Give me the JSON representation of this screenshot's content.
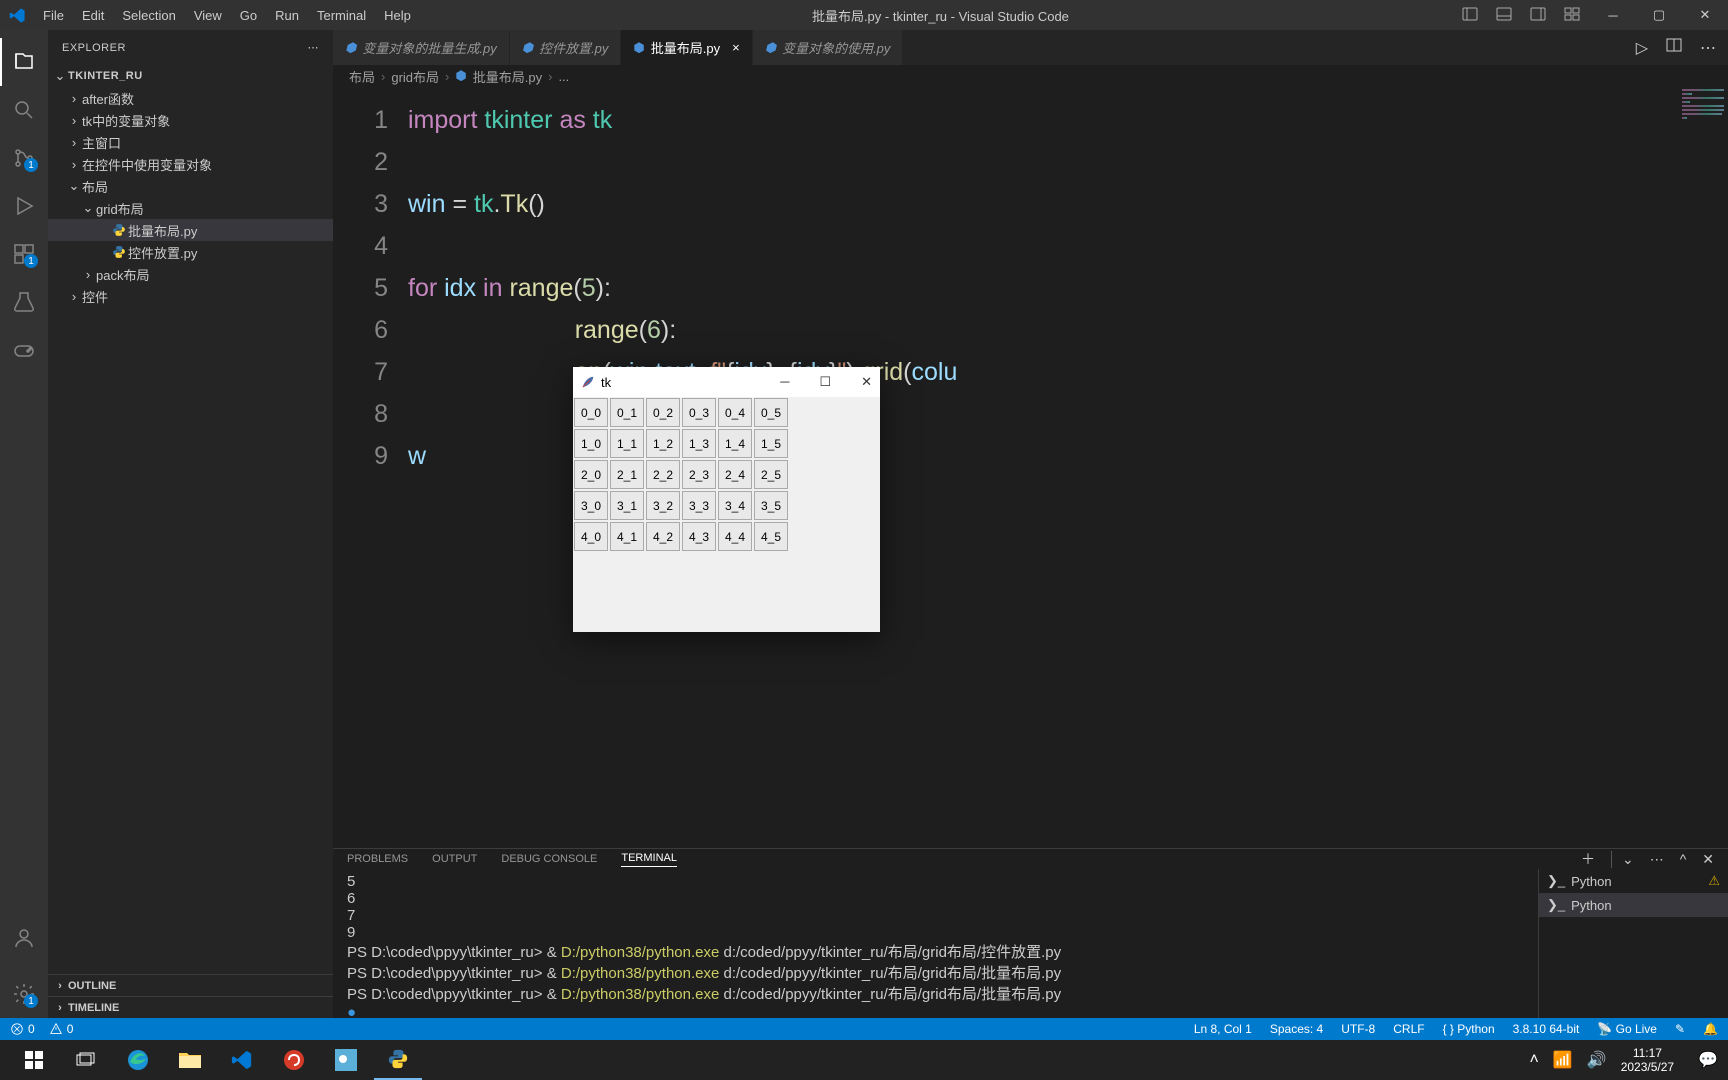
{
  "titlebar": {
    "menu": [
      "File",
      "Edit",
      "Selection",
      "View",
      "Go",
      "Run",
      "Terminal",
      "Help"
    ],
    "title": "批量布局.py - tkinter_ru - Visual Studio Code"
  },
  "activity": {
    "badge_scm": "1",
    "badge_ext": "1",
    "badge_settings": "1"
  },
  "sidebar": {
    "header": "EXPLORER",
    "root": "TKINTER_RU",
    "items": [
      {
        "label": "after函数",
        "indent": 1,
        "chev": ">"
      },
      {
        "label": "tk中的变量对象",
        "indent": 1,
        "chev": ">"
      },
      {
        "label": "主窗口",
        "indent": 1,
        "chev": ">"
      },
      {
        "label": "在控件中使用变量对象",
        "indent": 1,
        "chev": ">"
      },
      {
        "label": "布局",
        "indent": 1,
        "chev": "v"
      },
      {
        "label": "grid布局",
        "indent": 2,
        "chev": "v"
      },
      {
        "label": "批量布局.py",
        "indent": 3,
        "icon": "py",
        "selected": true
      },
      {
        "label": "控件放置.py",
        "indent": 3,
        "icon": "py"
      },
      {
        "label": "pack布局",
        "indent": 2,
        "chev": ">"
      },
      {
        "label": "控件",
        "indent": 1,
        "chev": ">"
      }
    ],
    "outline": "OUTLINE",
    "timeline": "TIMELINE"
  },
  "tabs": [
    {
      "label": "变量对象的批量生成.py",
      "icon": "py",
      "italic": true
    },
    {
      "label": "控件放置.py",
      "icon": "py",
      "italic": true
    },
    {
      "label": "批量布局.py",
      "icon": "py",
      "active": true,
      "close": "×"
    },
    {
      "label": "变量对象的使用.py",
      "icon": "py",
      "italic": true
    }
  ],
  "breadcrumb": [
    "布局",
    "grid布局",
    "批量布局.py",
    "..."
  ],
  "code": {
    "lines": [
      {
        "num": "1",
        "segments": [
          [
            "import ",
            "kw"
          ],
          [
            "tkinter ",
            "mod"
          ],
          [
            "as ",
            "kw"
          ],
          [
            "tk",
            "mod"
          ]
        ]
      },
      {
        "num": "2",
        "segments": []
      },
      {
        "num": "3",
        "segments": [
          [
            "win ",
            "var"
          ],
          [
            "= ",
            "punct"
          ],
          [
            "tk",
            "mod"
          ],
          [
            ".",
            "punct"
          ],
          [
            "Tk",
            "func"
          ],
          [
            "()",
            "punct"
          ]
        ]
      },
      {
        "num": "4",
        "segments": []
      },
      {
        "num": "5",
        "segments": [
          [
            "for ",
            "kw"
          ],
          [
            "idx ",
            "var"
          ],
          [
            "in ",
            "kw"
          ],
          [
            "range",
            "func"
          ],
          [
            "(",
            "punct"
          ],
          [
            "5",
            "num"
          ],
          [
            "):",
            "punct"
          ]
        ]
      },
      {
        "num": "6",
        "segments": [
          [
            "                        range",
            "func"
          ],
          [
            "(",
            "punct"
          ],
          [
            "6",
            "num"
          ],
          [
            "):",
            "punct"
          ]
        ]
      },
      {
        "num": "7",
        "segments": [
          [
            "                        on",
            "func"
          ],
          [
            "(",
            "punct"
          ],
          [
            "win",
            "var"
          ],
          [
            ",",
            "punct"
          ],
          [
            "text",
            "var"
          ],
          [
            "=",
            "punct"
          ],
          [
            "f\"",
            "str"
          ],
          [
            "{",
            "punct"
          ],
          [
            "idx",
            "var"
          ],
          [
            "}",
            "punct"
          ],
          [
            "_",
            "str"
          ],
          [
            "{",
            "punct"
          ],
          [
            "idy",
            "var"
          ],
          [
            "}",
            "punct"
          ],
          [
            "\"",
            "str"
          ],
          [
            ").",
            "punct"
          ],
          [
            "grid",
            "func"
          ],
          [
            "(",
            "punct"
          ],
          [
            "colu",
            "var"
          ]
        ]
      },
      {
        "num": "8",
        "segments": []
      },
      {
        "num": "9",
        "segments": [
          [
            "w",
            "var"
          ]
        ]
      }
    ]
  },
  "panel": {
    "tabs": [
      "PROBLEMS",
      "OUTPUT",
      "DEBUG CONSOLE",
      "TERMINAL"
    ],
    "active_tab": "TERMINAL",
    "lines": [
      "5",
      "6",
      "7",
      "9",
      "PS D:\\coded\\ppyy\\tkinter_ru> & D:/python38/python.exe d:/coded/ppyy/tkinter_ru/布局/grid布局/控件放置.py",
      "PS D:\\coded\\ppyy\\tkinter_ru> & D:/python38/python.exe d:/coded/ppyy/tkinter_ru/布局/grid布局/批量布局.py",
      "PS D:\\coded\\ppyy\\tkinter_ru> & D:/python38/python.exe d:/coded/ppyy/tkinter_ru/布局/grid布局/批量布局.py"
    ],
    "terminals": [
      {
        "label": "Python",
        "warn": true
      },
      {
        "label": "Python",
        "active": true
      }
    ]
  },
  "statusbar": {
    "errors": "0",
    "warnings": "0",
    "ln_col": "Ln 8, Col 1",
    "spaces": "Spaces: 4",
    "encoding": "UTF-8",
    "eol": "CRLF",
    "lang": "Python",
    "interp": "3.8.10 64-bit",
    "golive": "Go Live"
  },
  "taskbar": {
    "clock_time": "11:17",
    "clock_date": "2023/5/27"
  },
  "tkwin": {
    "title": "tk",
    "rows": 5,
    "cols": 6,
    "cells": [
      [
        "0_0",
        "0_1",
        "0_2",
        "0_3",
        "0_4",
        "0_5"
      ],
      [
        "1_0",
        "1_1",
        "1_2",
        "1_3",
        "1_4",
        "1_5"
      ],
      [
        "2_0",
        "2_1",
        "2_2",
        "2_3",
        "2_4",
        "2_5"
      ],
      [
        "3_0",
        "3_1",
        "3_2",
        "3_3",
        "3_4",
        "3_5"
      ],
      [
        "4_0",
        "4_1",
        "4_2",
        "4_3",
        "4_4",
        "4_5"
      ]
    ]
  }
}
